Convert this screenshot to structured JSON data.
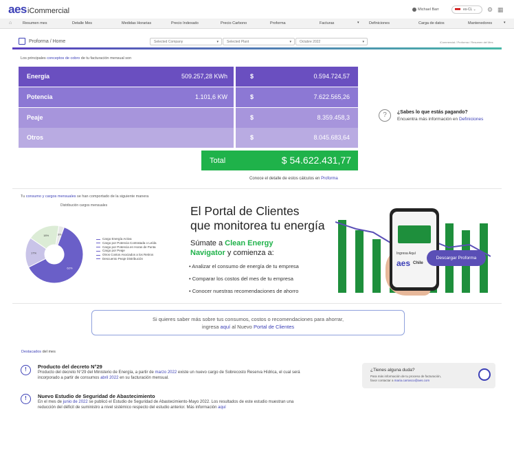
{
  "header": {
    "brand": "aes",
    "app": "iCommercial",
    "user": "Michael Barr",
    "lang": "es-CL"
  },
  "nav": [
    "Resumen mes",
    "Detalle Mes",
    "Medidas Horarias",
    "Precio Indexado",
    "Precio Carbono",
    "Proforma",
    "Facturas",
    "Definiciones",
    "Carga de datos",
    "Mantenedores"
  ],
  "breadcrumb": {
    "title": "Proforma / Home",
    "company": "Selected Company",
    "plant": "Selected Plant",
    "month": "Octubre 2022",
    "right": "iCommercial / Proforma / Resumen del Mes"
  },
  "intro": {
    "pre": "Los principales",
    "link": "conceptos de cobro",
    "post": "de tu facturación mensual son"
  },
  "rows": [
    {
      "label": "Energía",
      "qty": "509.257,28 KWh",
      "cur": "$",
      "amount": "0.594.724,57",
      "color": "#6a4fc0"
    },
    {
      "label": "Potencia",
      "qty": "1.101,6 KW",
      "cur": "$",
      "amount": "7.622.565,26",
      "color": "#8c78d4"
    },
    {
      "label": "Peaje",
      "qty": "",
      "cur": "$",
      "amount": "8.359.458,3",
      "color": "#a795dc"
    },
    {
      "label": "Otros",
      "qty": "",
      "cur": "$",
      "amount": "8.045.683,64",
      "color": "#b9abe2"
    }
  ],
  "total": {
    "label": "Total",
    "value": "$ 54.622.431,77"
  },
  "detail": {
    "pre": "Conoce el detalle de estos cálculos en",
    "link": "Proforma"
  },
  "question": {
    "title": "¿Sabes lo que estás pagando?",
    "pre": "Encuentra más información en",
    "link": "Definiciones"
  },
  "consumption": {
    "pre": "Tu",
    "link": "consumo y cargos mensuales",
    "post": "se han comportado de la siguiente manera",
    "chart_title": "Distribución cargos mensuales",
    "legend": [
      "Cargo Energía Activa",
      "Cargo por Potencia Contratada o Leída",
      "Cargo por Potencia en Horas de Punta",
      "Cargo por Peaje",
      "Otros Costos Asociados a los Retiros",
      "Descuento Peaje Distribución"
    ]
  },
  "chart_data": {
    "type": "pie",
    "title": "Distribución cargos mensuales",
    "categories": [
      "Cargo Energía Activa",
      "Cargo por Potencia Contratada o Leída",
      "Cargo por Potencia en Horas de Punta",
      "Cargo por Peaje",
      "Otros Costos Asociados a los Retiros",
      "Descuento Peaje Distribución"
    ],
    "values": [
      62,
      17,
      18,
      3,
      0,
      0
    ],
    "colors": [
      "#6a5fc8",
      "#c9c4e8",
      "#dcecd6",
      "#e8e8e8",
      "#bbbbbb",
      "#444444"
    ]
  },
  "banner": {
    "title1": "El Portal de Clientes",
    "title2": "que monitorea tu energía",
    "sub_pre": "Súmate a",
    "sub_green": "Clean Energy",
    "sub_green2": "Navigator",
    "sub_post": "y comienza a:",
    "items": [
      "Analizar el consumo de energía de tu empresa",
      "Comparar los costos del mes de tu empresa",
      "Conocer nuestras recomendaciones de ahorro"
    ],
    "button": "Descargar Proforma",
    "phone_label": "Ingresa Aquí",
    "phone_brand": "aes",
    "phone_country": "Chile"
  },
  "portal": {
    "line1": "Si quieres saber más sobre tus consumos, costos o recomendaciones para ahorrar,",
    "pre": "ingresa",
    "link1": "aquí",
    "mid": "al Nuevo",
    "link2": "Portal de Clientes"
  },
  "destacados": {
    "pre": "Destacados",
    "post": "del mes",
    "items": [
      {
        "title": "Producto del decreto N°29",
        "b1": "Producto del decreto N°29 del Ministerio de Energía, a partir de",
        "l1": "marzo 2022",
        "b2": "existe un nuevo cargo de Sobrecosto Reserva Hídrica, el cual será",
        "b3": "incorporado a partir de consumos",
        "l2": "abril 2022",
        "b4": "en su facturación mensual."
      },
      {
        "title": "Nuevo Estudio de Seguridad de Abastecimiento",
        "b1": "En el mes de",
        "l1": "junio de 2022",
        "b2": "se publicó el Estudio de Seguridad de Abastecimiento-Mayo 2022. Los resultados de este estudio muestran una",
        "b3": "reducción del déficit de suministro a nivel sistémico respecto del estudio anterior. Más información",
        "l2": "aquí"
      }
    ]
  },
  "help": {
    "title": "¿Tienes alguna duda?",
    "line1": "Para más información de tu proceso de facturación,",
    "pre": "favor contactar a",
    "link": "maria.carrasco@aes.com"
  }
}
